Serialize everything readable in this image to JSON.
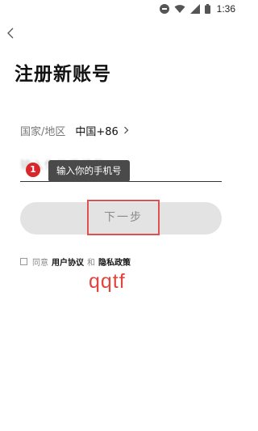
{
  "status_bar": {
    "time": "1:36",
    "icons": [
      "do-not-disturb-icon",
      "wifi-icon",
      "signal-icon",
      "battery-icon"
    ]
  },
  "nav": {
    "back_icon": "chevron-left-icon"
  },
  "title": "注册新账号",
  "region": {
    "label": "国家/地区",
    "value": "中国+86"
  },
  "phone": {
    "placeholder": "输入你的手机号",
    "error_badge": "1",
    "tooltip": "输入你的手机号"
  },
  "next_button": {
    "label": "下一步"
  },
  "agreement": {
    "prefix": "同意",
    "user_agreement": "用户协议",
    "and": "和",
    "privacy_policy": "隐私政策"
  },
  "annotation": {
    "text": "qqtf"
  },
  "colors": {
    "annotation_red": "#e0453e",
    "badge_red": "#d8262b",
    "button_gray": "#e3e3e3",
    "tooltip_bg": "#4a4a4a"
  }
}
